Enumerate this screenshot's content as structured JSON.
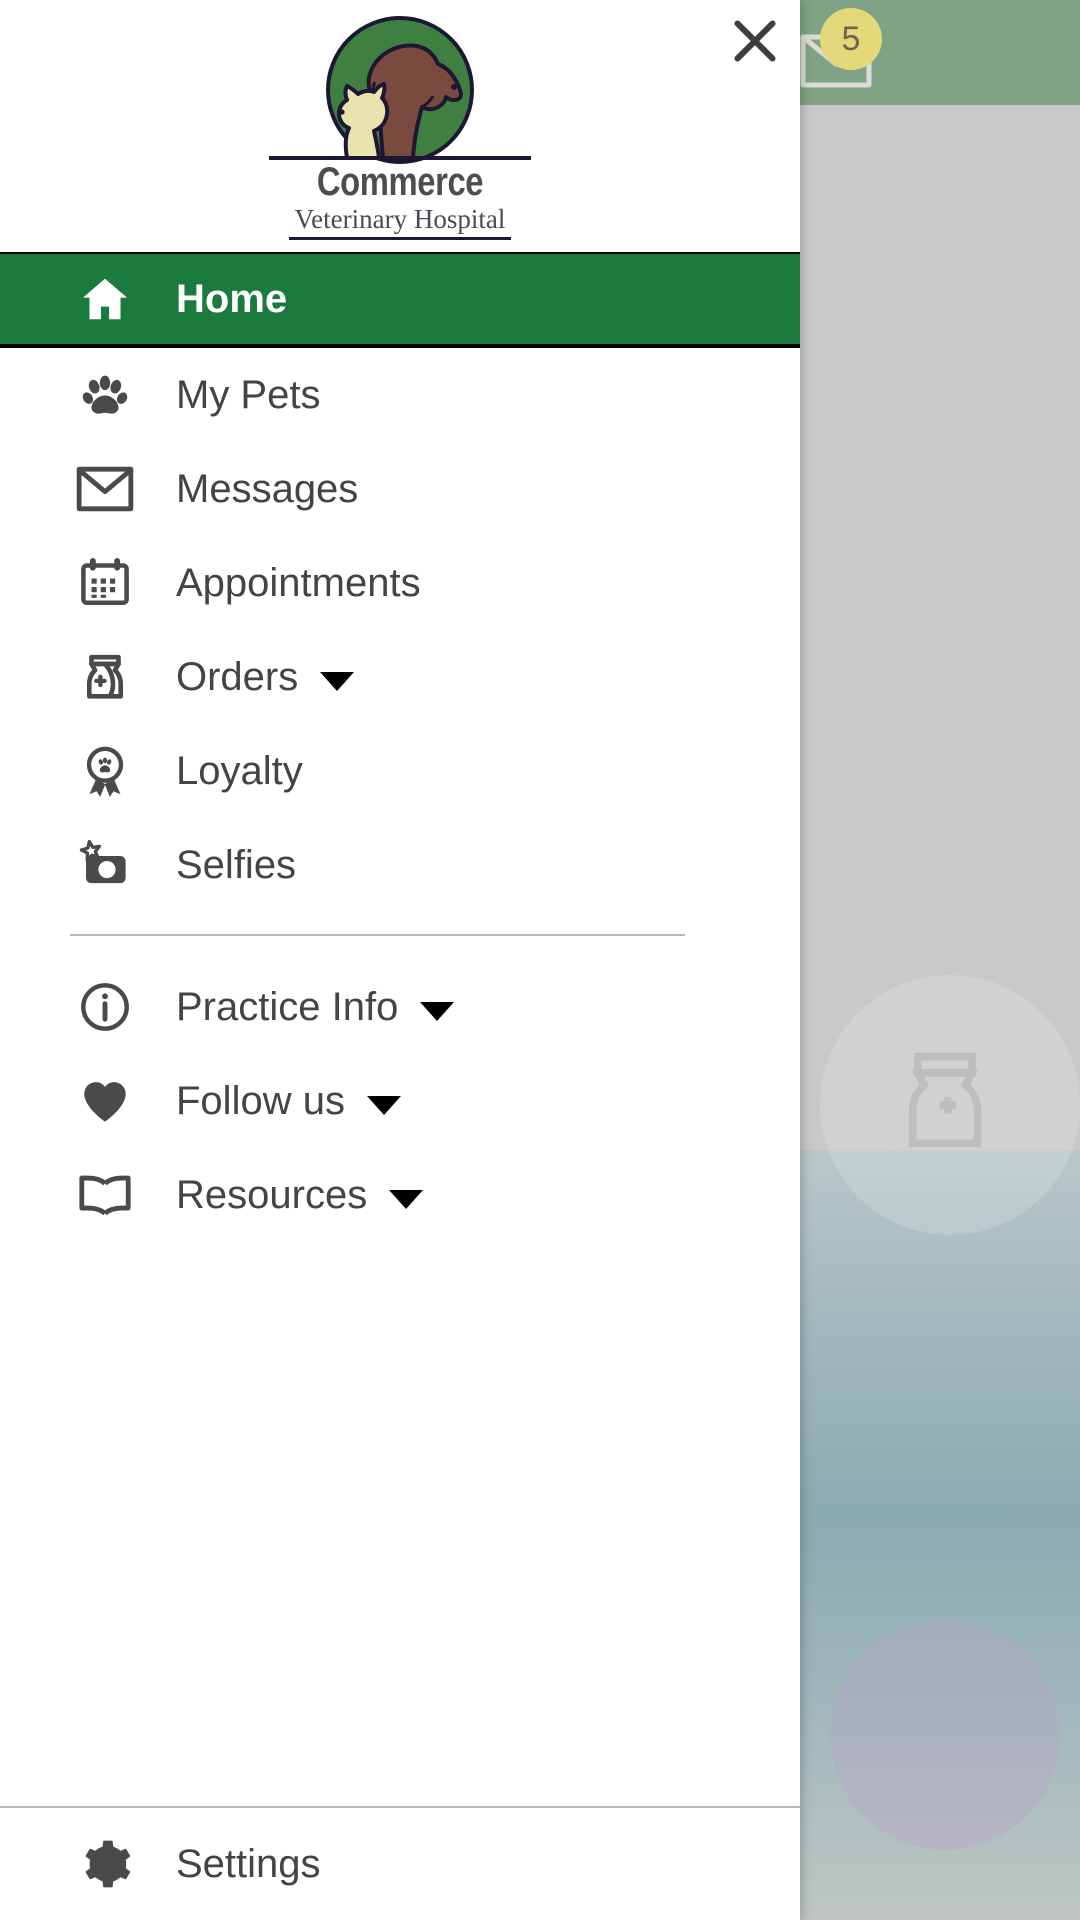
{
  "background": {
    "header": {
      "mail_icon": "mail-icon",
      "badge_count": "5"
    },
    "colors": {
      "header_green": "#7fa383",
      "badge_yellow": "#e3d87a",
      "dim_grey": "#c9c9c9"
    }
  },
  "drawer": {
    "close_label": "×",
    "close_icon": "close-icon",
    "logo": {
      "name": "Commerce",
      "subtitle": "Veterinary Hospital",
      "icon": "vet-hospital-logo",
      "colors": {
        "circle_green": "#3f7f42",
        "dog_brown": "#7b4a3f",
        "cat_cream": "#e9e3ae",
        "outline": "#1d1733"
      }
    },
    "nav": {
      "primary": [
        {
          "label": "Home",
          "icon": "home-icon",
          "active": true,
          "has_caret": false
        },
        {
          "label": "My Pets",
          "icon": "paw-icon",
          "active": false,
          "has_caret": false
        },
        {
          "label": "Messages",
          "icon": "mail-icon",
          "active": false,
          "has_caret": false
        },
        {
          "label": "Appointments",
          "icon": "calendar-icon",
          "active": false,
          "has_caret": false
        },
        {
          "label": "Orders",
          "icon": "food-bag-icon",
          "active": false,
          "has_caret": true
        },
        {
          "label": "Loyalty",
          "icon": "award-paw-icon",
          "active": false,
          "has_caret": false
        },
        {
          "label": "Selfies",
          "icon": "camera-star-icon",
          "active": false,
          "has_caret": false
        }
      ],
      "secondary": [
        {
          "label": "Practice Info",
          "icon": "info-circle-icon",
          "active": false,
          "has_caret": true
        },
        {
          "label": "Follow us",
          "icon": "heart-icon",
          "active": false,
          "has_caret": true
        },
        {
          "label": "Resources",
          "icon": "book-icon",
          "active": false,
          "has_caret": true
        }
      ],
      "footer": [
        {
          "label": "Settings",
          "icon": "gear-icon",
          "active": false,
          "has_caret": false
        }
      ]
    },
    "accent_color": "#1b7a3d"
  }
}
